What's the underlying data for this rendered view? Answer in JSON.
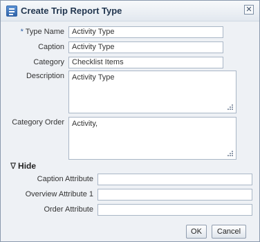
{
  "dialog": {
    "title": "Create Trip Report Type",
    "close_symbol": "✕"
  },
  "form": {
    "type_name": {
      "required_marker": "*",
      "label": "Type Name",
      "value": "Activity Type"
    },
    "caption": {
      "label": "Caption",
      "value": "Activity Type"
    },
    "category": {
      "label": "Category",
      "value": "Checklist Items"
    },
    "description": {
      "label": "Description",
      "value": "Activity Type"
    },
    "category_order": {
      "label": "Category Order",
      "value": "Activity,"
    }
  },
  "hide_section": {
    "toggle_symbol": "∇",
    "title": "Hide",
    "caption_attribute": {
      "label": "Caption Attribute",
      "value": ""
    },
    "overview_attribute_1": {
      "label": "Overview Attribute 1",
      "value": ""
    },
    "order_attribute": {
      "label": "Order Attribute",
      "value": ""
    }
  },
  "buttons": {
    "ok": "OK",
    "cancel": "Cancel"
  },
  "icons": [
    "dialog-icon",
    "close-icon",
    "collapse-triangle-icon",
    "resize-grip-icon"
  ]
}
